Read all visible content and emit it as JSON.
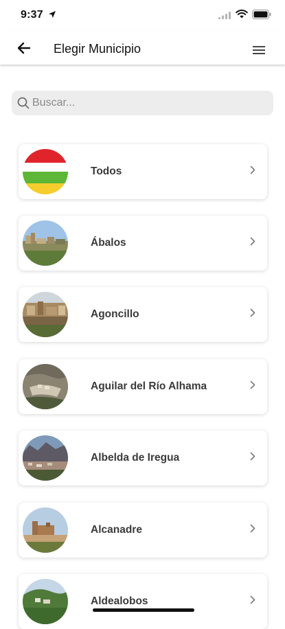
{
  "status_bar": {
    "time": "9:37"
  },
  "header": {
    "title": "Elegir Municipio"
  },
  "search": {
    "placeholder": "Buscar..."
  },
  "municipalities": [
    {
      "label": "Todos",
      "image": "la-rioja-flag"
    },
    {
      "label": "Ábalos",
      "image": "town-photo"
    },
    {
      "label": "Agoncillo",
      "image": "town-photo"
    },
    {
      "label": "Aguilar del Río Alhama",
      "image": "town-photo"
    },
    {
      "label": "Albelda de Iregua",
      "image": "town-photo"
    },
    {
      "label": "Alcanadre",
      "image": "town-photo"
    },
    {
      "label": "Aldealobos",
      "image": "town-photo"
    }
  ],
  "colors": {
    "flag_red": "#e0242b",
    "flag_white": "#ffffff",
    "flag_green": "#5db635",
    "flag_yellow": "#f5cd2c"
  }
}
